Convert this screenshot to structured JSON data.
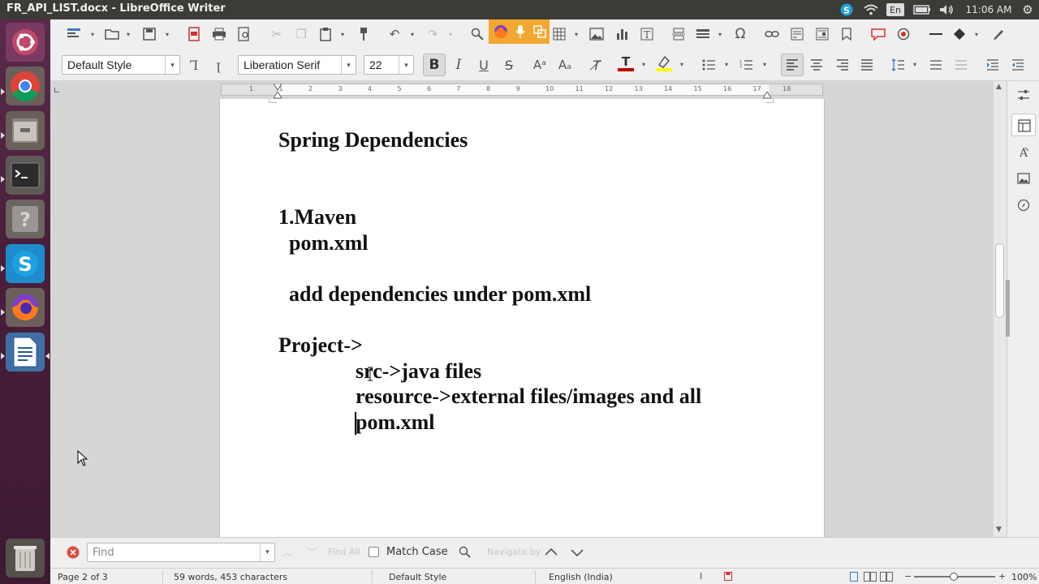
{
  "window": {
    "title": "FR_API_LIST.docx - LibreOffice Writer"
  },
  "tray": {
    "keyboard": "En",
    "time": "11:06 AM"
  },
  "formatting": {
    "paragraph_style": "Default Style",
    "font_name": "Liberation Serif",
    "font_size": "22"
  },
  "ruler": {
    "ticks": [
      "1",
      "1",
      "2",
      "3",
      "4",
      "5",
      "6",
      "7",
      "8",
      "9",
      "10",
      "11",
      "12",
      "13",
      "14",
      "15",
      "16",
      "17",
      "18"
    ]
  },
  "document": {
    "heading": "Spring Dependencies",
    "lines": [
      "1.Maven",
      "pom.xml",
      "add dependencies under pom.xml",
      "Project->",
      "src->java files",
      "resource->external files/images and all",
      "pom.xml"
    ]
  },
  "findbar": {
    "placeholder": "Find",
    "find_all": "Find All",
    "match_case": "Match Case",
    "navigate_by": "Navigate by"
  },
  "statusbar": {
    "page": "Page 2 of 3",
    "words": "59 words, 453 characters",
    "style": "Default Style",
    "language": "English (India)",
    "zoom": "100%"
  },
  "colors": {
    "launcher": "#4a1f3c",
    "panel": "#3c3b37",
    "font_color_bar": "#c00000",
    "highlight_bar": "#ffff00"
  }
}
